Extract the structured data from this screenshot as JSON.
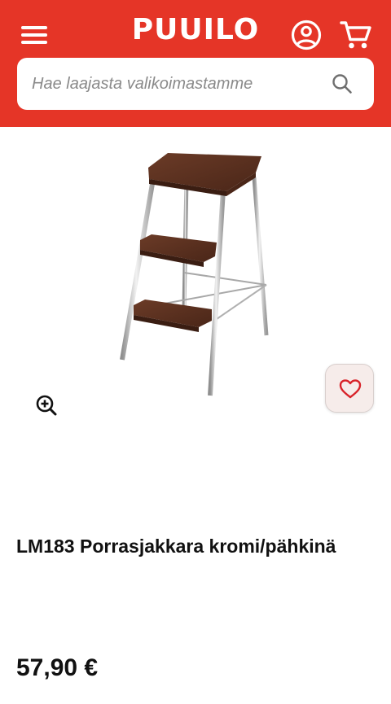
{
  "header": {
    "brand_color": "#e53527",
    "logo_text": "PUUILO",
    "menu_icon": "hamburger-menu-icon",
    "account_icon": "user-account-icon",
    "cart_icon": "shopping-cart-icon"
  },
  "search": {
    "placeholder": "Hae laajasta valikoimastamme",
    "value": "",
    "icon": "search-icon"
  },
  "product": {
    "image_alt": "brown wooden step stool with chrome legs",
    "zoom_icon": "zoom-in-icon",
    "favorite_icon": "heart-icon",
    "title": "LM183 Porrasjakkara kromi/pähkinä",
    "price": "57,90 €"
  }
}
